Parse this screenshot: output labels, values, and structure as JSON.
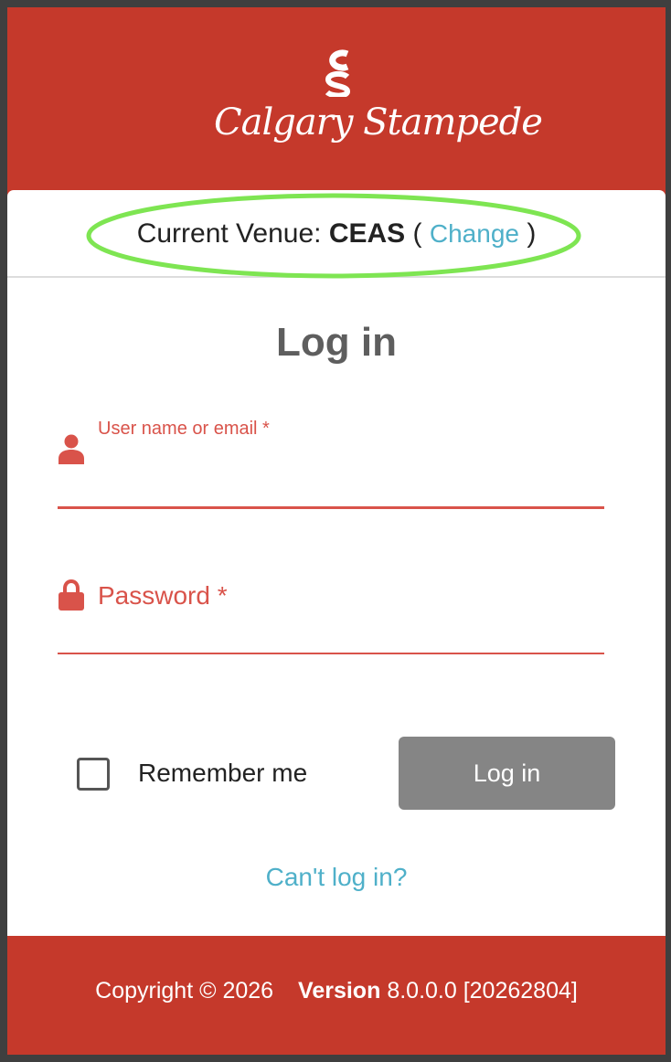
{
  "brand": {
    "monogram": "CS",
    "name": "Calgary Stampede",
    "colors": {
      "primary": "#c5392b",
      "accent_red": "#d9534a",
      "link": "#4fb0c9",
      "highlight_ring": "#7ee552",
      "button": "#858585"
    }
  },
  "venue": {
    "prefix": "Current Venue:",
    "name": "CEAS",
    "open_paren": "(",
    "change_label": "Change",
    "close_paren": ")"
  },
  "login": {
    "title": "Log in",
    "username": {
      "label": "User name or email *",
      "value": "",
      "icon": "user-icon"
    },
    "password": {
      "label": "Password *",
      "value": "",
      "icon": "lock-icon"
    },
    "remember": {
      "label": "Remember me",
      "checked": false
    },
    "submit_label": "Log in",
    "cant_login_label": "Can't log in?"
  },
  "footer": {
    "copyright": "Copyright © 2026",
    "version_label": "Version",
    "version_value": "8.0.0.0 [20262804]"
  }
}
